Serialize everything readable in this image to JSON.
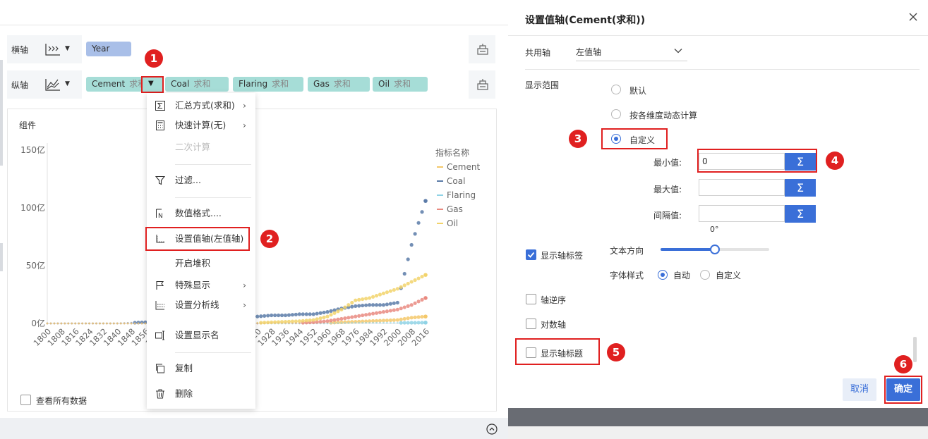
{
  "shelves": {
    "x_axis": {
      "label": "横轴",
      "fields": [
        "Year"
      ]
    },
    "y_axis": {
      "label": "纵轴",
      "fields": [
        {
          "name": "Cement",
          "agg": "求和"
        },
        {
          "name": "Coal",
          "agg": "求和"
        },
        {
          "name": "Flaring",
          "agg": "求和"
        },
        {
          "name": "Gas",
          "agg": "求和"
        },
        {
          "name": "Oil",
          "agg": "求和"
        }
      ]
    }
  },
  "component": {
    "title": "组件"
  },
  "view_all_data": "查看所有数据",
  "context_menu": {
    "items": [
      {
        "label": "汇总方式(求和)",
        "icon": "sigma-icon",
        "submenu": true
      },
      {
        "label": "快速计算(无)",
        "icon": "calculator-icon",
        "submenu": true
      },
      {
        "label": "二次计算",
        "icon": "",
        "disabled": true
      },
      {
        "label": "过滤...",
        "icon": "filter-icon"
      },
      {
        "label": "数值格式....",
        "icon": "number-format-icon"
      },
      {
        "label": "设置值轴(左值轴)",
        "icon": "axis-settings-icon"
      },
      {
        "label": "开启堆积",
        "icon": ""
      },
      {
        "label": "特殊显示",
        "icon": "flag-icon",
        "submenu": true
      },
      {
        "label": "设置分析线",
        "icon": "analysis-line-icon",
        "submenu": true
      },
      {
        "label": "设置显示名",
        "icon": "rename-icon"
      },
      {
        "label": "复制",
        "icon": "copy-icon"
      },
      {
        "label": "删除",
        "icon": "trash-icon"
      }
    ]
  },
  "badges": [
    "1",
    "2",
    "3",
    "4",
    "5",
    "6"
  ],
  "dialog": {
    "title": "设置值轴(Cement(求和))",
    "shared_axis_label": "共用轴",
    "shared_axis_value": "左值轴",
    "display_range_label": "显示范围",
    "range_options": [
      "默认",
      "按各维度动态计算",
      "自定义"
    ],
    "range_selected": 2,
    "min_label": "最小值:",
    "min_value": "0",
    "max_label": "最大值:",
    "max_value": "",
    "interval_label": "间隔值:",
    "interval_value": "",
    "show_axis_labels": "显示轴标签",
    "show_axis_labels_checked": true,
    "text_direction_label": "文本方向",
    "text_direction_value": "0°",
    "text_direction_fraction": 0.5,
    "font_style_label": "字体样式",
    "font_style_options": [
      "自动",
      "自定义"
    ],
    "font_style_selected": 0,
    "reverse_axis": "轴逆序",
    "log_axis": "对数轴",
    "show_axis_title": "显示轴标题",
    "cancel": "取消",
    "ok": "确定"
  },
  "colors": {
    "accent": "#3a6fd8",
    "highlight": "#e02020",
    "cement": "#f4c86a",
    "coal": "#5b7ba8",
    "flaring": "#8fd3e6",
    "gas": "#e98a80",
    "oil": "#f2d36b"
  },
  "chart_data": {
    "type": "scatter",
    "x": [
      1800,
      1808,
      1816,
      1824,
      1832,
      1840,
      1848,
      1856,
      1864,
      1872,
      1880,
      1888,
      1896,
      1904,
      1912,
      1920,
      1928,
      1936,
      1944,
      1952,
      1960,
      1968,
      1976,
      1984,
      1992,
      2000,
      2008,
      2016
    ],
    "x_ticks": [
      "1800",
      "1808",
      "1816",
      "1824",
      "1832",
      "1840",
      "1848",
      "1856",
      "1864",
      "1872",
      "1880",
      "1888",
      "1896",
      "1904",
      "1912",
      "1920",
      "1928",
      "1936",
      "1944",
      "1952",
      "1960",
      "1968",
      "1976",
      "1984",
      "1992",
      "2000",
      "2008",
      "2016"
    ],
    "y_ticks": [
      "0亿",
      "50亿",
      "100亿",
      "150亿"
    ],
    "ylim": [
      0,
      150
    ],
    "legend_title": "指标名称",
    "legend_position": "right",
    "series": [
      {
        "name": "Cement",
        "values": [
          0,
          0,
          0,
          0,
          0,
          0,
          0,
          0,
          0,
          0,
          0,
          0,
          0,
          0,
          0,
          0,
          0.1,
          0.1,
          0.1,
          0.2,
          0.5,
          1,
          1.5,
          2,
          2.5,
          3,
          5,
          6
        ]
      },
      {
        "name": "Coal",
        "values": [
          0,
          0,
          0,
          0,
          0,
          0,
          0.5,
          1,
          1.5,
          2,
          3,
          3.5,
          4,
          5,
          6,
          6,
          7,
          7,
          8,
          8,
          10,
          13,
          15,
          16,
          16,
          18,
          68,
          106
        ]
      },
      {
        "name": "Flaring",
        "values": [
          0,
          0,
          0,
          0,
          0,
          0,
          0,
          0,
          0,
          0,
          0,
          0,
          0,
          0,
          0,
          0,
          0,
          0,
          0,
          0,
          0,
          0.3,
          0.5,
          0.5,
          0.5,
          0.5,
          0.6,
          0.7
        ]
      },
      {
        "name": "Gas",
        "values": [
          0,
          0,
          0,
          0,
          0,
          0,
          0,
          0,
          0,
          0,
          0,
          0,
          0,
          0,
          0,
          0,
          0.5,
          0.5,
          0.5,
          1,
          2,
          4,
          6,
          8,
          10,
          12,
          16,
          22
        ]
      },
      {
        "name": "Oil",
        "values": [
          0,
          0,
          0,
          0,
          0,
          0,
          0,
          0,
          0,
          0,
          0,
          0,
          0,
          0,
          0,
          0.5,
          1,
          1.5,
          2,
          3,
          6,
          12,
          20,
          22,
          26,
          30,
          36,
          42
        ]
      }
    ]
  }
}
